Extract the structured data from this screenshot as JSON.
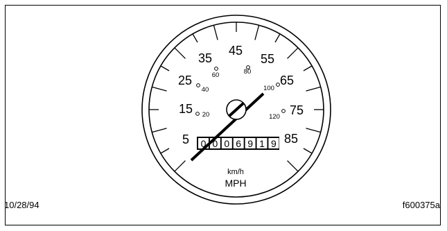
{
  "speedometer": {
    "mph_labels": [
      "5",
      "15",
      "25",
      "35",
      "45",
      "55",
      "65",
      "75",
      "85"
    ],
    "kmh_labels": [
      "20",
      "40",
      "60",
      "80",
      "100",
      "120"
    ],
    "odometer_digits": [
      "0",
      "0",
      "0",
      "6",
      "9",
      "1",
      "9"
    ],
    "unit_kmh": "km/h",
    "unit_mph": "MPH",
    "needle_reading_mph": 60
  },
  "footer": {
    "date": "10/28/94",
    "figure_id": "f600375a"
  }
}
